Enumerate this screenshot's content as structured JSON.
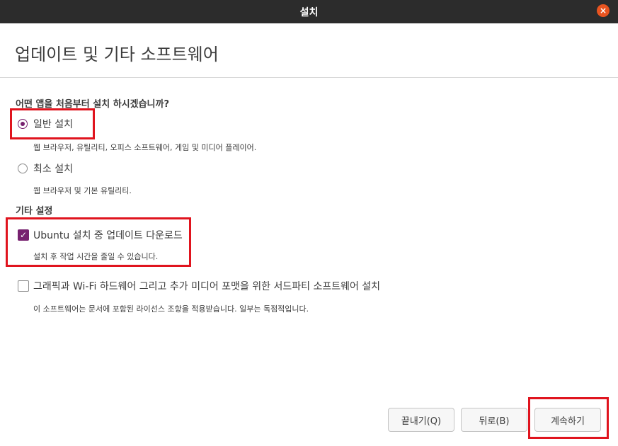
{
  "window": {
    "title": "설치",
    "close_glyph": "×"
  },
  "page": {
    "title": "업데이트 및 기타 소프트웨어"
  },
  "question": "어떤 앱을 처음부터 설치 하시겠습니까?",
  "install_options": [
    {
      "label": "일반 설치",
      "description": "웹 브라우저, 유틸리티, 오피스  소프트웨어, 게임 및 미디어 플레이어.",
      "selected": true
    },
    {
      "label": "최소 설치",
      "description": "웹 브라우저 및 기본 유틸리티.",
      "selected": false
    }
  ],
  "other_settings": {
    "heading": "기타 설정",
    "options": [
      {
        "label": "Ubuntu 설치 중 업데이트 다운로드",
        "description": "설치 후 작업 시간을 줄일 수 있습니다.",
        "checked": true,
        "check_glyph": "✓"
      },
      {
        "label": "그래픽과 Wi-Fi 하드웨어 그리고 추가 미디어 포맷을 위한 서드파티 소프트웨어 설치",
        "description": "이 소프트웨어는 문서에 포함된 라이선스 조항을 적용받습니다. 일부는 독점적입니다.",
        "checked": false,
        "check_glyph": ""
      }
    ]
  },
  "buttons": {
    "quit": "끝내기(Q)",
    "back": "뒤로(B)",
    "continue": "계속하기"
  },
  "colors": {
    "accent": "#77216f",
    "highlight": "#e0141e",
    "titlebar": "#2c2c2c",
    "close": "#e95420"
  }
}
